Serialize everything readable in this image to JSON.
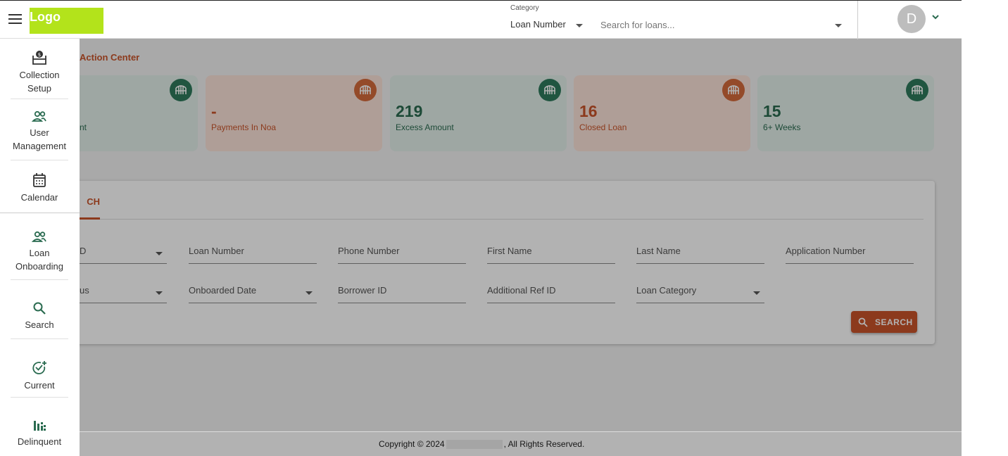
{
  "header": {
    "logo_text": "Logo",
    "category_label": "Category",
    "category_value": "Loan Number",
    "search_placeholder": "Search for loans...",
    "avatar_initial": "D"
  },
  "main": {
    "section_title": "Action Center",
    "cards": [
      {
        "value": "",
        "label": "nt",
        "variant": "green"
      },
      {
        "value": "-",
        "label": "Payments In Noa",
        "variant": "orange"
      },
      {
        "value": "219",
        "label": "Excess Amount",
        "variant": "green"
      },
      {
        "value": "16",
        "label": "Closed Loan",
        "variant": "orange"
      },
      {
        "value": "15",
        "label": "6+ Weeks",
        "variant": "green"
      }
    ],
    "tab_label": "CH",
    "fields_row1": [
      "D",
      "Loan Number",
      "Phone Number",
      "First Name",
      "Last Name",
      "Application Number"
    ],
    "fields_row2": [
      "us",
      "Onboarded Date",
      "Borrower ID",
      "Additional Ref ID",
      "Loan Category"
    ],
    "search_button": "SEARCH"
  },
  "footer": {
    "copyright_prefix": "Copyright © 2024",
    "copyright_suffix": ", All Rights Reserved."
  },
  "sidebar": {
    "items": [
      {
        "line1": "Collection",
        "line2": "Setup",
        "icon": "collection-icon"
      },
      {
        "line1": "User",
        "line2": "Management",
        "icon": "users-icon"
      },
      {
        "line1": "Calendar",
        "line2": "",
        "icon": "calendar-icon"
      },
      {
        "line1": "Loan",
        "line2": "Onboarding",
        "icon": "users-icon"
      },
      {
        "line1": "Search",
        "line2": "",
        "icon": "search-icon"
      },
      {
        "line1": "Current",
        "line2": "",
        "icon": "check-plus-icon"
      },
      {
        "line1": "Delinquent",
        "line2": "",
        "icon": "bar-chart-icon"
      }
    ]
  },
  "colors": {
    "accent": "#c9542a",
    "green": "#2a6b50",
    "logo": "#b3e31b"
  }
}
